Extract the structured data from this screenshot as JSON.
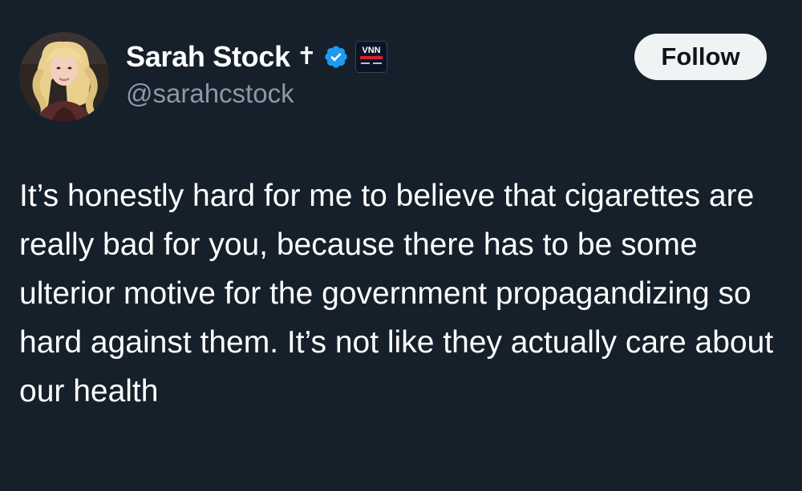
{
  "author": {
    "display_name": "Sarah Stock",
    "name_emoji": "✝",
    "handle": "@sarahcstock",
    "affiliate_badge_text": "VNN"
  },
  "actions": {
    "follow_label": "Follow"
  },
  "tweet": {
    "text": "It’s honestly hard for me to believe that cigarettes are really bad for you, because there has to be some ulterior motive for the government propagandizing so hard against them. It’s not like they actually care about our health"
  },
  "icons": {
    "verified": "verified-badge-icon",
    "cross": "latin-cross-emoji"
  },
  "colors": {
    "background": "#15202b",
    "primary_text": "#ffffff",
    "secondary_text": "#8b98a5",
    "verified_blue": "#1d9bf0",
    "follow_button_bg": "#eff3f4",
    "follow_button_text": "#0f1419"
  }
}
